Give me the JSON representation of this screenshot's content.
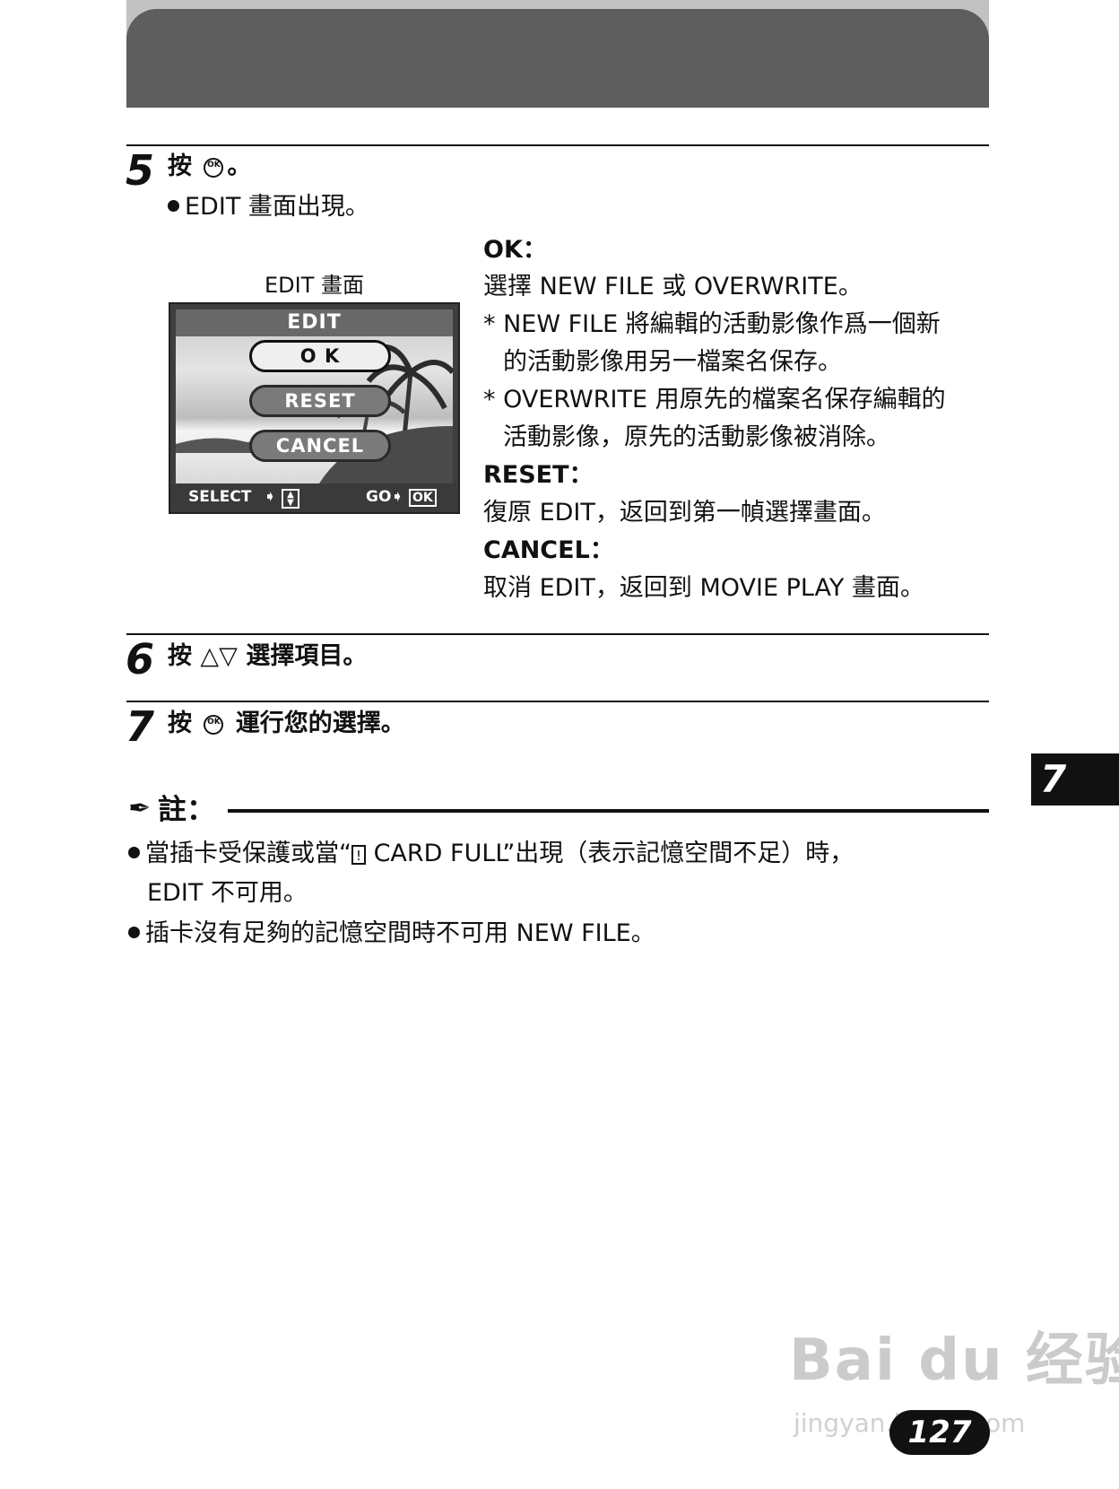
{
  "step5": {
    "number": "5",
    "press": "按",
    "ok_icon": "OK",
    "end": "。",
    "sub": "EDIT 畫面出現。"
  },
  "figure": {
    "caption": "EDIT 畫面",
    "screen_title": "EDIT",
    "buttons": [
      "O K",
      "RESET",
      "CANCEL"
    ],
    "selected": "O K",
    "status_select": "SELECT",
    "status_go": "GO",
    "status_ok": "OK"
  },
  "options": {
    "ok_label": "OK：",
    "ok_text": "選擇 NEW FILE 或 OVERWRITE。",
    "note1_line1": "* NEW FILE 將編輯的活動影像作爲一個新",
    "note1_line2": "的活動影像用另一檔案名保存。",
    "note2_line1": "* OVERWRITE 用原先的檔案名保存編輯的",
    "note2_line2": "活動影像，原先的活動影像被消除。",
    "reset_label": "RESET：",
    "reset_text": "復原 EDIT，返回到第一幀選擇畫面。",
    "cancel_label": "CANCEL：",
    "cancel_text": "取消 EDIT，返回到 MOVIE PLAY 畫面。"
  },
  "step6": {
    "number": "6",
    "text": "按 △▽ 選擇項目。"
  },
  "step7": {
    "number": "7",
    "press": "按",
    "ok_icon": "OK",
    "text": "運行您的選擇。"
  },
  "note": {
    "heading": "註：",
    "item1_line1": "當插卡受保護或當“",
    "item1_icon": "!",
    "item1_line1b": " CARD FULL”出現（表示記憶空間不足）時，",
    "item1_line2": "EDIT 不可用。",
    "item2": "插卡沒有足夠的記憶空間時不可用 NEW FILE。"
  },
  "chapter_tab": "7",
  "page_number": "127",
  "watermark": {
    "brand": "Bai du 经验",
    "url": "jingyan.baidu.com"
  }
}
